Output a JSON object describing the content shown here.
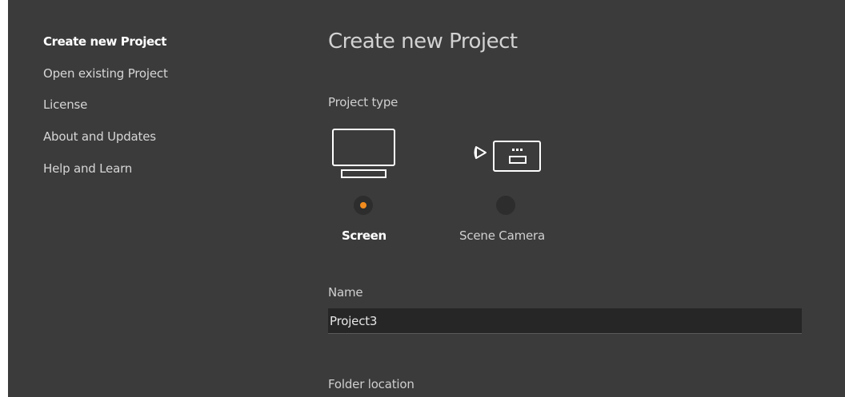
{
  "sidebar": {
    "items": [
      {
        "label": "Create new Project",
        "active": true
      },
      {
        "label": "Open existing Project",
        "active": false
      },
      {
        "label": "License",
        "active": false
      },
      {
        "label": "About and Updates",
        "active": false
      },
      {
        "label": "Help and Learn",
        "active": false
      }
    ]
  },
  "main": {
    "title": "Create new Project",
    "project_type": {
      "label": "Project type",
      "options": [
        {
          "label": "Screen",
          "icon": "monitor-icon",
          "selected": true
        },
        {
          "label": "Scene Camera",
          "icon": "scene-camera-icon",
          "selected": false
        }
      ]
    },
    "name": {
      "label": "Name",
      "value": "Project3"
    },
    "folder": {
      "label": "Folder location"
    }
  },
  "colors": {
    "background": "#3b3b3b",
    "input_background": "#262626",
    "accent": "#f28c1e",
    "radio_off": "#2d2d2d"
  }
}
